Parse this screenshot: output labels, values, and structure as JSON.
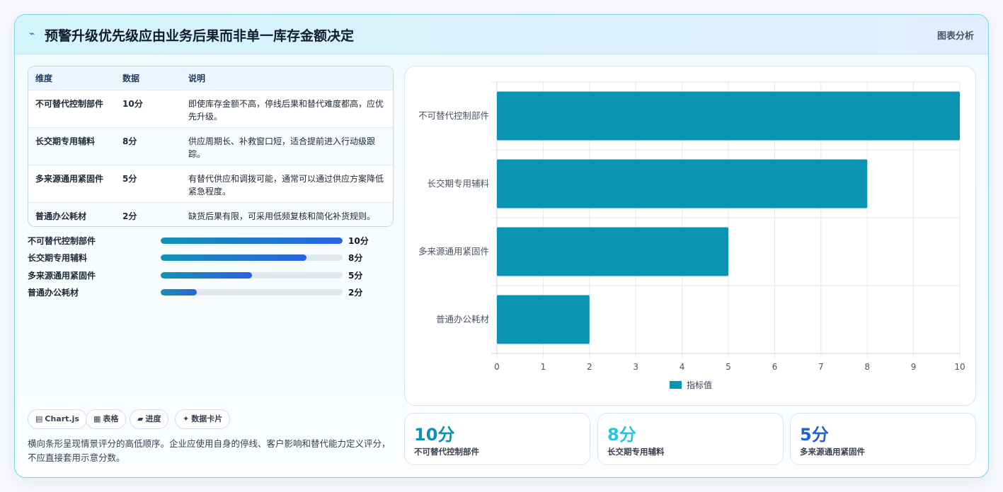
{
  "header": {
    "title": "预警升级优先级应由业务后果而非单一库存金额决定",
    "tag": "图表分析"
  },
  "table": {
    "columns": [
      "维度",
      "数据",
      "说明"
    ],
    "rows": [
      {
        "dim": "不可替代控制部件",
        "value": "10分",
        "note": "即使库存金额不高，停线后果和替代难度都高，应优先升级。"
      },
      {
        "dim": "长交期专用辅料",
        "value": "8分",
        "note": "供应周期长、补救窗口短，适合提前进入行动级跟踪。"
      },
      {
        "dim": "多来源通用紧固件",
        "value": "5分",
        "note": "有替代供应和调拨可能，通常可以通过供应方案降低紧急程度。"
      },
      {
        "dim": "普通办公耗材",
        "value": "2分",
        "note": "缺货后果有限，可采用低频复核和简化补货规则。"
      }
    ]
  },
  "progress": [
    {
      "label": "不可替代控制部件",
      "value_text": "10分",
      "fraction": 1.0
    },
    {
      "label": "长交期专用辅料",
      "value_text": "8分",
      "fraction": 0.8
    },
    {
      "label": "多来源通用紧固件",
      "value_text": "5分",
      "fraction": 0.5
    },
    {
      "label": "普通办公耗材",
      "value_text": "2分",
      "fraction": 0.2
    }
  ],
  "chips": [
    {
      "icon": "▤",
      "icon_name": "chart-icon",
      "label": "Chart.js"
    },
    {
      "icon": "▦",
      "icon_name": "table-icon",
      "label": "表格"
    },
    {
      "icon": "▰",
      "icon_name": "progress-icon",
      "label": "进度"
    },
    {
      "icon": "✦",
      "icon_name": "sparkle-icon",
      "label": "数据卡片"
    }
  ],
  "description": "横向条形呈现情景评分的高低顺序。企业应使用自身的停线、客户影响和替代能力定义评分，不应直接套用示意分数。",
  "stats": [
    {
      "value": "10分",
      "label": "不可替代控制部件",
      "color": "#0b93b2"
    },
    {
      "value": "8分",
      "label": "长交期专用辅料",
      "color": "#29c3dc"
    },
    {
      "value": "5分",
      "label": "多来源通用紧固件",
      "color": "#2361d8"
    }
  ],
  "colors": {
    "bar": "#0b93b2",
    "accent": "#2a63e0"
  },
  "chart_data": {
    "type": "bar",
    "orientation": "horizontal",
    "categories": [
      "不可替代控制部件",
      "长交期专用辅料",
      "多来源通用紧固件",
      "普通办公耗材"
    ],
    "series": [
      {
        "name": "指标值",
        "values": [
          10,
          8,
          5,
          2
        ],
        "color": "#0b93b2"
      }
    ],
    "xlim": [
      0,
      10
    ],
    "xticks": [
      "0",
      "1",
      "2",
      "3",
      "4",
      "5",
      "6",
      "7",
      "8",
      "9",
      "10"
    ],
    "grid": true,
    "legend": "bottom"
  }
}
